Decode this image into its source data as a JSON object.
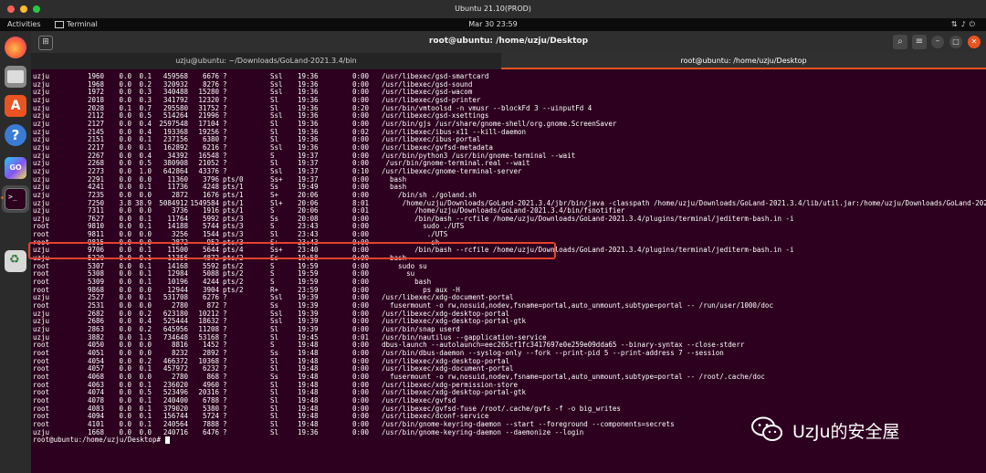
{
  "vm_window": {
    "title": "Ubuntu 21.10(PROD)"
  },
  "gnome_bar": {
    "activities": "Activities",
    "app": "Terminal",
    "clock": "Mar 30  23:59"
  },
  "terminal_window": {
    "title": "root@ubuntu: /home/uzju/Desktop",
    "tabs": [
      {
        "label": "uzju@ubuntu: ~/Downloads/GoLand-2021.3.4/bin",
        "active": false
      },
      {
        "label": "root@ubuntu: /home/uzju/Desktop",
        "active": true
      }
    ]
  },
  "ps_rows": [
    {
      "user": "uzju",
      "pid": "1960",
      "cpu": "0.0",
      "mem": "0.1",
      "vsz": "459568",
      "rss": "6676",
      "tty": "?",
      "stat": "Ssl",
      "start": "19:36",
      "time": "0:00",
      "cmd": "/usr/libexec/gsd-smartcard"
    },
    {
      "user": "uzju",
      "pid": "1968",
      "cpu": "0.0",
      "mem": "0.2",
      "vsz": "320932",
      "rss": "8276",
      "tty": "?",
      "stat": "Ssl",
      "start": "19:36",
      "time": "0:00",
      "cmd": "/usr/libexec/gsd-sound"
    },
    {
      "user": "uzju",
      "pid": "1972",
      "cpu": "0.0",
      "mem": "0.3",
      "vsz": "340488",
      "rss": "15280",
      "tty": "?",
      "stat": "Ssl",
      "start": "19:36",
      "time": "0:00",
      "cmd": "/usr/libexec/gsd-wacom"
    },
    {
      "user": "uzju",
      "pid": "2018",
      "cpu": "0.0",
      "mem": "0.3",
      "vsz": "341792",
      "rss": "12320",
      "tty": "?",
      "stat": "Sl",
      "start": "19:36",
      "time": "0:00",
      "cmd": "/usr/libexec/gsd-printer"
    },
    {
      "user": "uzju",
      "pid": "2028",
      "cpu": "0.1",
      "mem": "0.7",
      "vsz": "295580",
      "rss": "31752",
      "tty": "?",
      "stat": "Sl",
      "start": "19:36",
      "time": "0:20",
      "cmd": "/usr/bin/vmtoolsd -n vmusr --blockFd 3 --uinputFd 4"
    },
    {
      "user": "uzju",
      "pid": "2112",
      "cpu": "0.0",
      "mem": "0.5",
      "vsz": "514264",
      "rss": "21996",
      "tty": "?",
      "stat": "Ssl",
      "start": "19:36",
      "time": "0:00",
      "cmd": "/usr/libexec/gsd-xsettings"
    },
    {
      "user": "uzju",
      "pid": "2127",
      "cpu": "0.0",
      "mem": "0.4",
      "vsz": "2597548",
      "rss": "17104",
      "tty": "?",
      "stat": "Sl",
      "start": "19:36",
      "time": "0:00",
      "cmd": "/usr/bin/gjs /usr/share/gnome-shell/org.gnome.ScreenSaver"
    },
    {
      "user": "uzju",
      "pid": "2145",
      "cpu": "0.0",
      "mem": "0.4",
      "vsz": "193368",
      "rss": "19256",
      "tty": "?",
      "stat": "Sl",
      "start": "19:36",
      "time": "0:02",
      "cmd": "/usr/libexec/ibus-x11 --kill-daemon"
    },
    {
      "user": "uzju",
      "pid": "2151",
      "cpu": "0.0",
      "mem": "0.1",
      "vsz": "237156",
      "rss": "6380",
      "tty": "?",
      "stat": "Sl",
      "start": "19:36",
      "time": "0:00",
      "cmd": "/usr/libexec/ibus-portal"
    },
    {
      "user": "uzju",
      "pid": "2217",
      "cpu": "0.0",
      "mem": "0.1",
      "vsz": "162892",
      "rss": "6216",
      "tty": "?",
      "stat": "Ssl",
      "start": "19:36",
      "time": "0:00",
      "cmd": "/usr/libexec/gvfsd-metadata"
    },
    {
      "user": "uzju",
      "pid": "2267",
      "cpu": "0.0",
      "mem": "0.4",
      "vsz": "34392",
      "rss": "16548",
      "tty": "?",
      "stat": "S",
      "start": "19:37",
      "time": "0:00",
      "cmd": "/usr/bin/python3 /usr/bin/gnome-terminal --wait"
    },
    {
      "user": "uzju",
      "pid": "2268",
      "cpu": "0.0",
      "mem": "0.5",
      "vsz": "380908",
      "rss": "21052",
      "tty": "?",
      "stat": "Sl",
      "start": "19:37",
      "time": "0:00",
      "cmd": " /usr/bin/gnome-terminal.real --wait"
    },
    {
      "user": "uzju",
      "pid": "2273",
      "cpu": "0.0",
      "mem": "1.0",
      "vsz": "642864",
      "rss": "43376",
      "tty": "?",
      "stat": "Ssl",
      "start": "19:37",
      "time": "0:10",
      "cmd": "/usr/libexec/gnome-terminal-server"
    },
    {
      "user": "uzju",
      "pid": "2291",
      "cpu": "0.0",
      "mem": "0.0",
      "vsz": "11360",
      "rss": "3796",
      "tty": "pts/0",
      "stat": "Ss+",
      "start": "19:37",
      "time": "0:00",
      "cmd": "  bash"
    },
    {
      "user": "uzju",
      "pid": "4241",
      "cpu": "0.0",
      "mem": "0.1",
      "vsz": "11736",
      "rss": "4248",
      "tty": "pts/1",
      "stat": "Ss",
      "start": "19:49",
      "time": "0:00",
      "cmd": "  bash"
    },
    {
      "user": "uzju",
      "pid": "7235",
      "cpu": "0.0",
      "mem": "0.0",
      "vsz": "2872",
      "rss": "1676",
      "tty": "pts/1",
      "stat": "S+",
      "start": "20:06",
      "time": "0:00",
      "cmd": "    /bin/sh ./goland.sh"
    },
    {
      "user": "uzju",
      "pid": "7250",
      "cpu": "3.8",
      "mem": "38.9",
      "vsz": "5084912",
      "rss": "1549584",
      "tty": "pts/1",
      "stat": "Sl+",
      "start": "20:06",
      "time": "8:01",
      "cmd": "     /home/uzju/Downloads/GoLand-2021.3.4/jbr/bin/java -classpath /home/uzju/Downloads/GoLand-2021.3.4/lib/util.jar:/home/uzju/Downloads/GoLand-2021.3."
    },
    {
      "user": "uzju",
      "pid": "7311",
      "cpu": "0.0",
      "mem": "0.0",
      "vsz": "3736",
      "rss": "1916",
      "tty": "pts/1",
      "stat": "S",
      "start": "20:06",
      "time": "0:01",
      "cmd": "        /home/uzju/Downloads/GoLand-2021.3.4/bin/fsnotifier"
    },
    {
      "user": "uzju",
      "pid": "7627",
      "cpu": "0.0",
      "mem": "0.1",
      "vsz": "11764",
      "rss": "5992",
      "tty": "pts/3",
      "stat": "Ss",
      "start": "20:08",
      "time": "0:00",
      "cmd": "        /bin/bash --rcfile /home/uzju/Downloads/GoLand-2021.3.4/plugins/terminal/jediterm-bash.in -i"
    },
    {
      "user": "root",
      "pid": "9810",
      "cpu": "0.0",
      "mem": "0.1",
      "vsz": "14188",
      "rss": "5744",
      "tty": "pts/3",
      "stat": "S",
      "start": "23:43",
      "time": "0:00",
      "cmd": "          sudo ./UTS"
    },
    {
      "user": "root",
      "pid": "9811",
      "cpu": "0.0",
      "mem": "0.0",
      "vsz": "3256",
      "rss": "1544",
      "tty": "pts/3",
      "stat": "Sl",
      "start": "23:43",
      "time": "0:00",
      "cmd": "           ./UTS"
    },
    {
      "user": "root",
      "pid": "9815",
      "cpu": "0.0",
      "mem": "0.0",
      "vsz": "2872",
      "rss": "952",
      "tty": "pts/3",
      "stat": "S+",
      "start": "23:43",
      "time": "0:00",
      "cmd": "            sh"
    },
    {
      "user": "uzju",
      "pid": "9706",
      "cpu": "0.0",
      "mem": "0.1",
      "vsz": "11500",
      "rss": "5644",
      "tty": "pts/4",
      "stat": "Ss+",
      "start": "23:40",
      "time": "0:00",
      "cmd": "        /bin/bash --rcfile /home/uzju/Downloads/GoLand-2021.3.4/plugins/terminal/jediterm-bash.in -i"
    },
    {
      "user": "uzju",
      "pid": "5220",
      "cpu": "0.0",
      "mem": "0.1",
      "vsz": "11356",
      "rss": "4872",
      "tty": "pts/2",
      "stat": "Ss",
      "start": "19:58",
      "time": "0:00",
      "cmd": "  bash"
    },
    {
      "user": "root",
      "pid": "5307",
      "cpu": "0.0",
      "mem": "0.1",
      "vsz": "14168",
      "rss": "5592",
      "tty": "pts/2",
      "stat": "S",
      "start": "19:59",
      "time": "0:00",
      "cmd": "    sudo su"
    },
    {
      "user": "root",
      "pid": "5308",
      "cpu": "0.0",
      "mem": "0.1",
      "vsz": "12984",
      "rss": "5088",
      "tty": "pts/2",
      "stat": "S",
      "start": "19:59",
      "time": "0:00",
      "cmd": "      su"
    },
    {
      "user": "root",
      "pid": "5309",
      "cpu": "0.0",
      "mem": "0.1",
      "vsz": "10196",
      "rss": "4244",
      "tty": "pts/2",
      "stat": "S",
      "start": "19:59",
      "time": "0:00",
      "cmd": "        bash"
    },
    {
      "user": "root",
      "pid": "9868",
      "cpu": "0.0",
      "mem": "0.0",
      "vsz": "12944",
      "rss": "3904",
      "tty": "pts/2",
      "stat": "R+",
      "start": "23:59",
      "time": "0:00",
      "cmd": "          ps aux -H"
    },
    {
      "user": "uzju",
      "pid": "2527",
      "cpu": "0.0",
      "mem": "0.1",
      "vsz": "531708",
      "rss": "6276",
      "tty": "?",
      "stat": "Ssl",
      "start": "19:39",
      "time": "0:00",
      "cmd": "/usr/libexec/xdg-document-portal"
    },
    {
      "user": "root",
      "pid": "2531",
      "cpu": "0.0",
      "mem": "0.0",
      "vsz": "2780",
      "rss": "872",
      "tty": "?",
      "stat": "Ss",
      "start": "19:39",
      "time": "0:00",
      "cmd": "  fusermount -o rw,nosuid,nodev,fsname=portal,auto_unmount,subtype=portal -- /run/user/1000/doc"
    },
    {
      "user": "uzju",
      "pid": "2682",
      "cpu": "0.0",
      "mem": "0.2",
      "vsz": "623180",
      "rss": "10212",
      "tty": "?",
      "stat": "Ssl",
      "start": "19:39",
      "time": "0:00",
      "cmd": "/usr/libexec/xdg-desktop-portal"
    },
    {
      "user": "uzju",
      "pid": "2686",
      "cpu": "0.0",
      "mem": "0.4",
      "vsz": "525444",
      "rss": "18632",
      "tty": "?",
      "stat": "Ssl",
      "start": "19:39",
      "time": "0:00",
      "cmd": "/usr/libexec/xdg-desktop-portal-gtk"
    },
    {
      "user": "uzju",
      "pid": "2863",
      "cpu": "0.0",
      "mem": "0.2",
      "vsz": "645956",
      "rss": "11208",
      "tty": "?",
      "stat": "Sl",
      "start": "19:39",
      "time": "0:00",
      "cmd": "/usr/bin/snap userd"
    },
    {
      "user": "uzju",
      "pid": "3882",
      "cpu": "0.0",
      "mem": "1.3",
      "vsz": "734648",
      "rss": "53168",
      "tty": "?",
      "stat": "Sl",
      "start": "19:45",
      "time": "0:01",
      "cmd": "/usr/bin/nautilus --gapplication-service"
    },
    {
      "user": "root",
      "pid": "4050",
      "cpu": "0.0",
      "mem": "0.0",
      "vsz": "8816",
      "rss": "1452",
      "tty": "?",
      "stat": "S",
      "start": "19:48",
      "time": "0:00",
      "cmd": "dbus-launch --autolaunch=eec265cf1fc3417697e0e259e09dda65 --binary-syntax --close-stderr"
    },
    {
      "user": "root",
      "pid": "4051",
      "cpu": "0.0",
      "mem": "0.0",
      "vsz": "8232",
      "rss": "2892",
      "tty": "?",
      "stat": "Ss",
      "start": "19:48",
      "time": "0:00",
      "cmd": "/usr/bin/dbus-daemon --syslog-only --fork --print-pid 5 --print-address 7 --session"
    },
    {
      "user": "root",
      "pid": "4054",
      "cpu": "0.0",
      "mem": "0.2",
      "vsz": "466372",
      "rss": "10368",
      "tty": "?",
      "stat": "Sl",
      "start": "19:48",
      "time": "0:00",
      "cmd": "/usr/libexec/xdg-desktop-portal"
    },
    {
      "user": "root",
      "pid": "4057",
      "cpu": "0.0",
      "mem": "0.1",
      "vsz": "457972",
      "rss": "6232",
      "tty": "?",
      "stat": "Sl",
      "start": "19:48",
      "time": "0:00",
      "cmd": "/usr/libexec/xdg-document-portal"
    },
    {
      "user": "root",
      "pid": "4068",
      "cpu": "0.0",
      "mem": "0.0",
      "vsz": "2780",
      "rss": "868",
      "tty": "?",
      "stat": "Ss",
      "start": "19:48",
      "time": "0:00",
      "cmd": "  fusermount -o rw,nosuid,nodev,fsname=portal,auto_unmount,subtype=portal -- /root/.cache/doc"
    },
    {
      "user": "root",
      "pid": "4063",
      "cpu": "0.0",
      "mem": "0.1",
      "vsz": "236020",
      "rss": "4960",
      "tty": "?",
      "stat": "Sl",
      "start": "19:48",
      "time": "0:00",
      "cmd": "/usr/libexec/xdg-permission-store"
    },
    {
      "user": "root",
      "pid": "4074",
      "cpu": "0.0",
      "mem": "0.5",
      "vsz": "523496",
      "rss": "20316",
      "tty": "?",
      "stat": "Sl",
      "start": "19:48",
      "time": "0:00",
      "cmd": "/usr/libexec/xdg-desktop-portal-gtk"
    },
    {
      "user": "root",
      "pid": "4078",
      "cpu": "0.0",
      "mem": "0.1",
      "vsz": "240400",
      "rss": "6788",
      "tty": "?",
      "stat": "Sl",
      "start": "19:48",
      "time": "0:00",
      "cmd": "/usr/libexec/gvfsd"
    },
    {
      "user": "root",
      "pid": "4083",
      "cpu": "0.0",
      "mem": "0.1",
      "vsz": "379020",
      "rss": "5380",
      "tty": "?",
      "stat": "Sl",
      "start": "19:48",
      "time": "0:00",
      "cmd": "/usr/libexec/gvfsd-fuse /root/.cache/gvfs -f -o big_writes"
    },
    {
      "user": "root",
      "pid": "4094",
      "cpu": "0.0",
      "mem": "0.1",
      "vsz": "156744",
      "rss": "5724",
      "tty": "?",
      "stat": "Sl",
      "start": "19:48",
      "time": "0:00",
      "cmd": "/usr/libexec/dconf-service"
    },
    {
      "user": "root",
      "pid": "4101",
      "cpu": "0.0",
      "mem": "0.1",
      "vsz": "240564",
      "rss": "7888",
      "tty": "?",
      "stat": "Sl",
      "start": "19:48",
      "time": "0:00",
      "cmd": "/usr/bin/gnome-keyring-daemon --start --foreground --components=secrets"
    },
    {
      "user": "uzju",
      "pid": "1668",
      "cpu": "0.0",
      "mem": "0.0",
      "vsz": "240716",
      "rss": "6476",
      "tty": "?",
      "stat": "Sl",
      "start": "19:36",
      "time": "0:00",
      "cmd": "/usr/bin/gnome-keyring-daemon --daemonize --login"
    }
  ],
  "prompt": "root@ubuntu:/home/uzju/Desktop# ",
  "watermark": {
    "text": "UzJu的安全屋",
    "icon": "wechat-icon"
  },
  "colors": {
    "terminal_bg": "#2c001e",
    "highlight": "#e5412d",
    "accent": "#e95420"
  }
}
